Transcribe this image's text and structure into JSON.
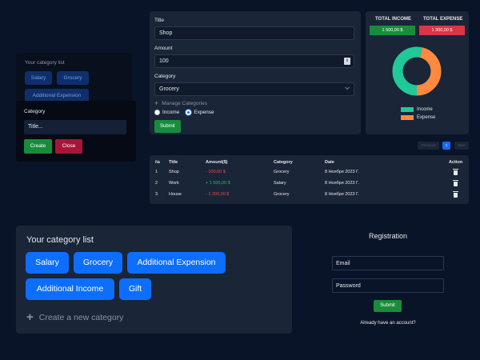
{
  "form": {
    "title_label": "Title",
    "title_value": "Shop",
    "amount_label": "Amount",
    "amount_value": "100",
    "category_label": "Category",
    "category_value": "Grocery",
    "manage_label": "Manage Categories",
    "radio_income": "Income",
    "radio_expense": "Expense",
    "selected_type": "Expense",
    "submit_label": "Submit"
  },
  "totals": {
    "income_header": "TOTAL INCOME",
    "income_value": "1 500,00 $",
    "expense_header": "TOTAL EXPENSE",
    "expense_value": "1 300,00 $",
    "legend_income": "Income",
    "legend_expense": "Expense",
    "colors": {
      "income": "#20c997",
      "expense": "#fd8a3e",
      "income_badge": "#198c3c",
      "expense_badge": "#dc3545"
    }
  },
  "chart_data": {
    "type": "pie",
    "categories": [
      "Income",
      "Expense"
    ],
    "values": [
      1500,
      1300
    ]
  },
  "pagination": {
    "prev": "Previous",
    "page": "1",
    "next": "Next"
  },
  "table": {
    "headers": [
      "№",
      "Title",
      "Amount($)",
      "Category",
      "Date",
      "Action"
    ],
    "rows": [
      {
        "n": "1",
        "title": "Shop",
        "amount": "- 100,00 $",
        "sign": "neg",
        "category": "Grocery",
        "date": "8 Ноября 2023 Г."
      },
      {
        "n": "2",
        "title": "Work",
        "amount": "+ 1 500,00 $",
        "sign": "pos",
        "category": "Salary",
        "date": "8 Ноября 2023 Г."
      },
      {
        "n": "3",
        "title": "House",
        "amount": "- 1 200,00 $",
        "sign": "neg",
        "category": "Grocery",
        "date": "8 Ноября 2023 Г."
      }
    ]
  },
  "category_small": {
    "title": "Your category list",
    "chips": [
      "Salary",
      "Grocery",
      "Additional Expension"
    ]
  },
  "modal": {
    "title": "Category",
    "placeholder": "Title...",
    "create_label": "Create",
    "close_label": "Close"
  },
  "category_large": {
    "title": "Your category list",
    "chips": [
      "Salary",
      "Grocery",
      "Additional Expension",
      "Additional Income",
      "Gift"
    ],
    "create_new": "Create a new category"
  },
  "registration": {
    "title": "Registration",
    "email_placeholder": "Email",
    "password_placeholder": "Password",
    "submit_label": "Submit",
    "login_link": "Already have an account?"
  }
}
